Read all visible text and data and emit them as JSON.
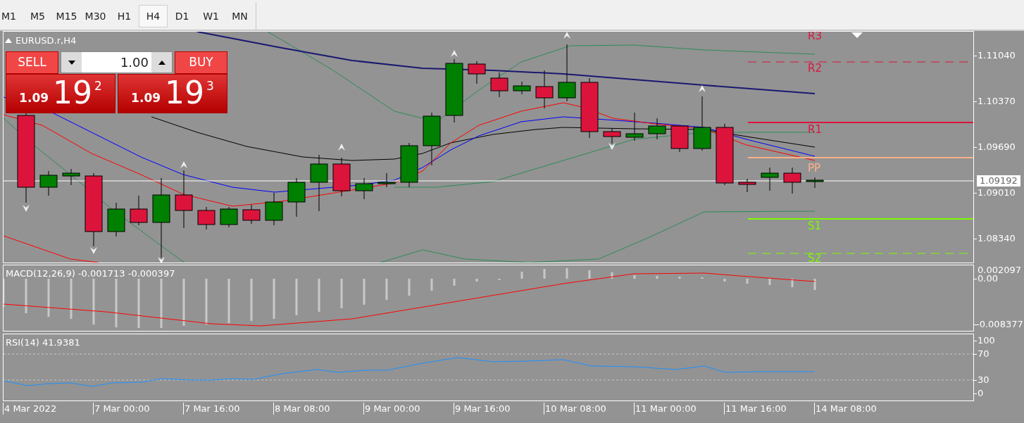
{
  "toolbar": {
    "timeframes": [
      {
        "label": "M1",
        "selected": false
      },
      {
        "label": "M5",
        "selected": false
      },
      {
        "label": "M15",
        "selected": false
      },
      {
        "label": "M30",
        "selected": false
      },
      {
        "label": "H1",
        "selected": false
      },
      {
        "label": "H4",
        "selected": true
      },
      {
        "label": "D1",
        "selected": false
      },
      {
        "label": "W1",
        "selected": false
      },
      {
        "label": "MN",
        "selected": false
      }
    ]
  },
  "chart": {
    "title": "EURUSD.r,H4",
    "trade_panel": {
      "sell": {
        "label": "SELL",
        "price_prefix": "1.09",
        "price_main": "19",
        "price_sup": "2"
      },
      "lot": {
        "value": "1.00"
      },
      "buy": {
        "label": "BUY",
        "price_prefix": "1.09",
        "price_main": "19",
        "price_sup": "3"
      }
    },
    "pivots": [
      {
        "label": "R3",
        "color": "#dc143c"
      },
      {
        "label": "R2",
        "color": "#dc143c",
        "kind": "dashed"
      },
      {
        "label": "R1",
        "color": "#dc143c",
        "kind": "solid"
      },
      {
        "label": "PP",
        "color": "#ffb08a",
        "kind": "solid"
      },
      {
        "label": "S1",
        "color": "#7cfc00",
        "kind": "solid"
      },
      {
        "label": "S2",
        "color": "#7cfc00",
        "kind": "dashed"
      }
    ],
    "price_axis": {
      "ticks": [
        "1.11040",
        "1.10370",
        "1.09690",
        "1.09010",
        "1.08340"
      ],
      "current_price": "1.09192"
    }
  },
  "macd": {
    "label": "MACD(12,26,9) -0.001713 -0.000397",
    "ticks": [
      "0.002097",
      "0.00",
      "-0.008377"
    ]
  },
  "rsi": {
    "label": "RSI(14) 41.9381",
    "ticks": [
      "100",
      "70",
      "30",
      "0"
    ]
  },
  "time_axis": {
    "labels": [
      "4 Mar 2022",
      "7 Mar 00:00",
      "7 Mar 16:00",
      "8 Mar 08:00",
      "9 Mar 00:00",
      "9 Mar 16:00",
      "10 Mar 08:00",
      "11 Mar 00:00",
      "11 Mar 16:00",
      "14 Mar 08:00"
    ]
  }
}
